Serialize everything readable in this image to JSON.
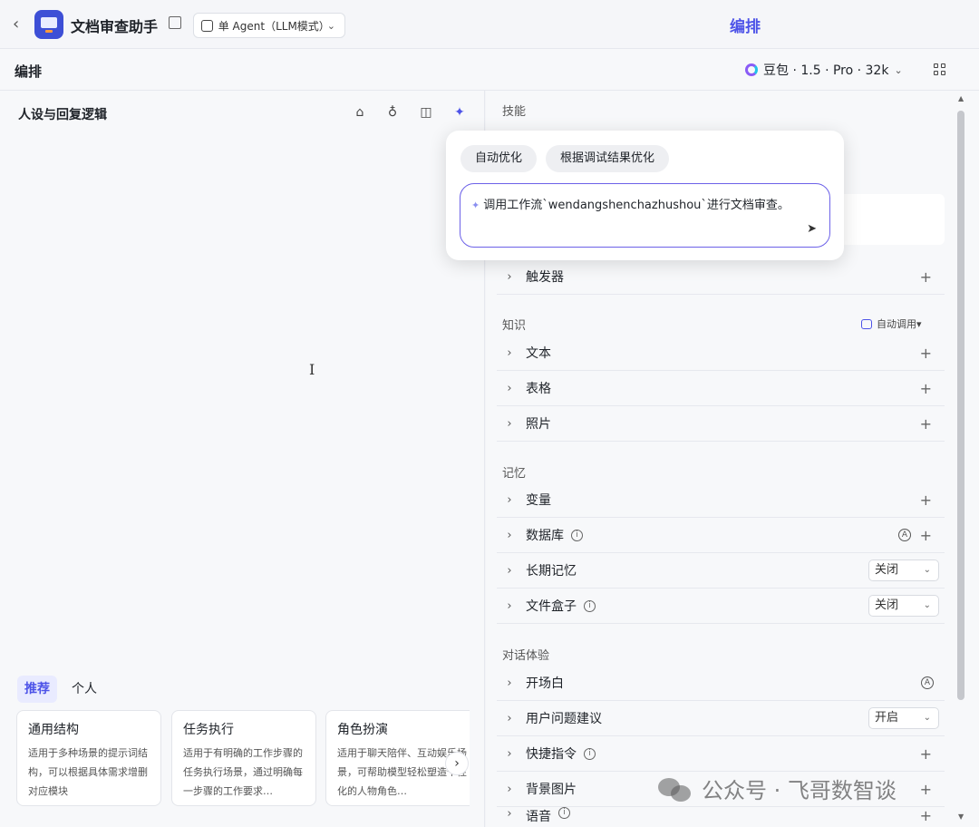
{
  "header": {
    "app_title": "文档审查助手",
    "mode_label": "单 Agent（LLM模式）",
    "center_title": "编排"
  },
  "subbar": {
    "title": "编排",
    "model": "豆包 · 1.5 · Pro · 32k"
  },
  "left_panel": {
    "title": "人设与回复逻辑",
    "tabs": [
      "推荐",
      "个人"
    ],
    "cards": [
      {
        "title": "通用结构",
        "desc": "适用于多种场景的提示词结构，可以根据具体需求增删对应模块"
      },
      {
        "title": "任务执行",
        "desc": "适用于有明确的工作步骤的任务执行场景，通过明确每一步骤的工作要求…"
      },
      {
        "title": "角色扮演",
        "desc": "适用于聊天陪伴、互动娱乐场景，可帮助模型轻松塑造个性化的人物角色…"
      }
    ]
  },
  "right_panel": {
    "skills_title": "技能",
    "trigger_label": "触发器",
    "knowledge_title": "知识",
    "knowledge_auto": "自动调用",
    "knowledge_items": [
      "文本",
      "表格",
      "照片"
    ],
    "memory_title": "记忆",
    "memory_items": {
      "variables": "变量",
      "database": "数据库",
      "long_term": "长期记忆",
      "long_term_value": "关闭",
      "file_box": "文件盒子",
      "file_box_value": "关闭"
    },
    "dialog_title": "对话体验",
    "dialog_items": {
      "opening": "开场白",
      "suggestion": "用户问题建议",
      "suggestion_value": "开启",
      "shortcut": "快捷指令",
      "background": "背景图片",
      "voice": "语音"
    }
  },
  "popup": {
    "chip_auto": "自动优化",
    "chip_debug": "根据调试结果优化",
    "prompt_text": "调用工作流`wendangshenchazhushou`进行文档审查。"
  },
  "watermark": "公众号 · 飞哥数智谈"
}
